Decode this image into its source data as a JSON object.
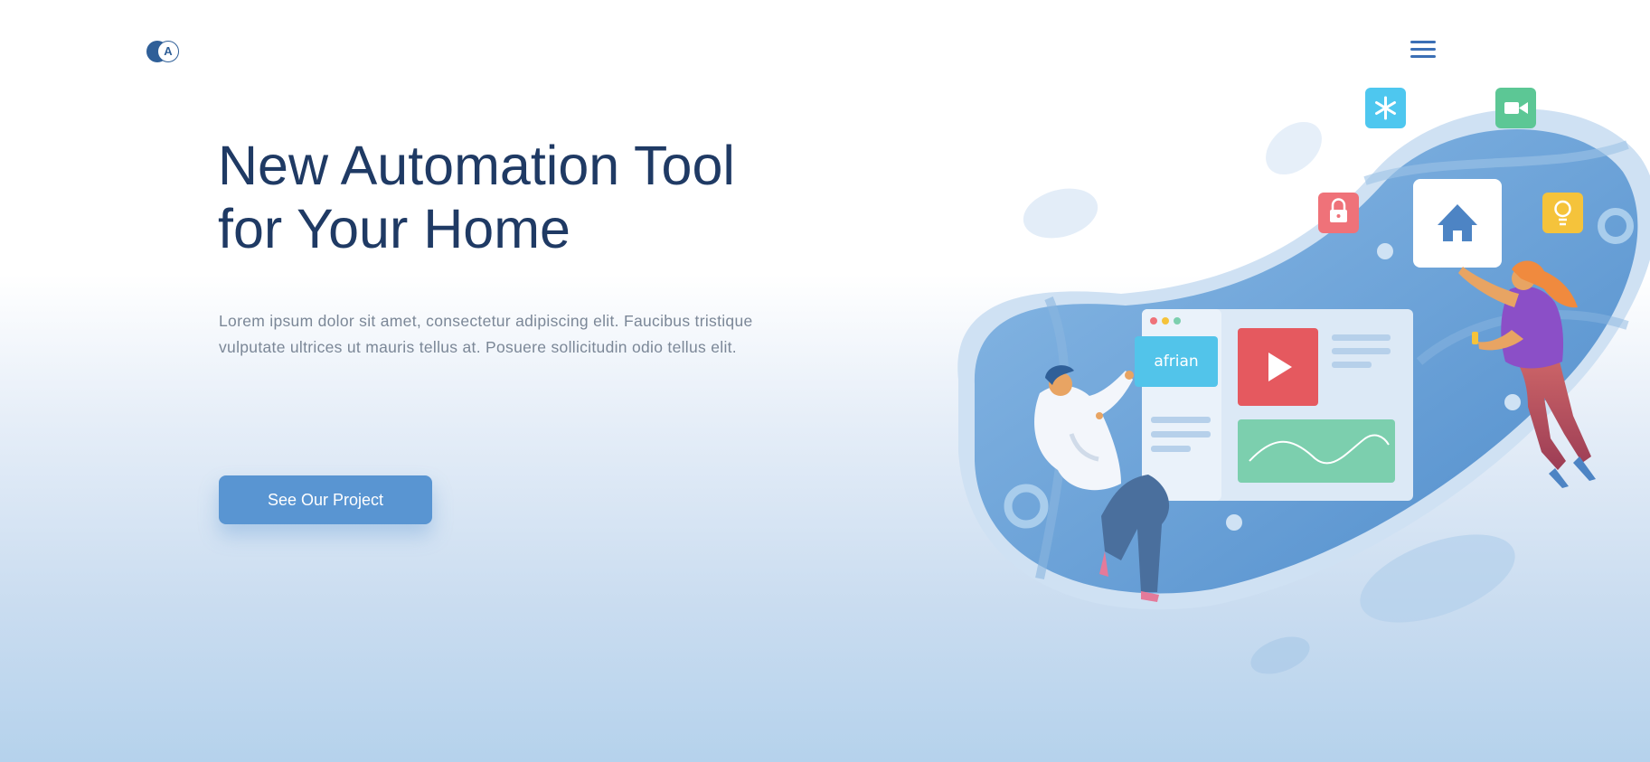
{
  "header": {
    "logo_letter": "A",
    "menu_icon": "hamburger-menu-icon"
  },
  "hero": {
    "title_line1": "New Automation Tool",
    "title_line2": "for Your Home",
    "description": "Lorem ipsum dolor sit amet, consectetur adipiscing elit. Faucibus tristique vulputate ultrices ut mauris tellus at. Posuere sollicitudin odio tellus elit.",
    "cta_label": "See Our Project"
  },
  "illustration": {
    "app_label": "afrian",
    "icons": [
      "snowflake-icon",
      "video-camera-icon",
      "lock-icon",
      "home-icon",
      "lightbulb-icon",
      "play-icon"
    ]
  },
  "colors": {
    "title": "#1f3a64",
    "accent": "#5995d2",
    "blob": "#5e9bd4",
    "snowflake_tile": "#4ec7ef",
    "camera_tile": "#5cc795",
    "lock_tile": "#ef7279",
    "bulb_tile": "#f5c33b",
    "play_tile": "#e5595f",
    "chart_tile": "#7ccfae"
  }
}
